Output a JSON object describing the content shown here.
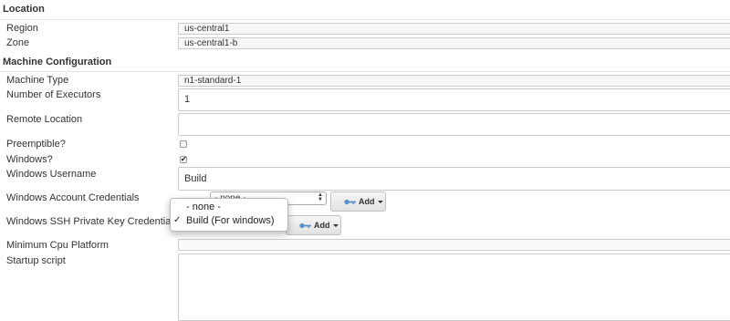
{
  "location": {
    "title": "Location",
    "region_label": "Region",
    "region_value": "us-central1",
    "zone_label": "Zone",
    "zone_value": "us-central1-b"
  },
  "machine": {
    "title": "Machine Configuration",
    "machine_type_label": "Machine Type",
    "machine_type_value": "n1-standard-1",
    "executors_label": "Number of Executors",
    "executors_value": "1",
    "remote_location_label": "Remote Location",
    "remote_location_value": "",
    "preemptible_label": "Preemptible?",
    "preemptible_checked": false,
    "windows_label": "Windows?",
    "windows_checked": true,
    "windows_checkmark": "✔",
    "windows_username_label": "Windows Username",
    "windows_username_value": "Build",
    "account_credentials_label": "Windows Account Credentials",
    "account_credentials_selected": "- none -",
    "ssh_key_label": "Windows SSH Private Key Credentials",
    "add_button_label": "Add",
    "min_cpu_label": "Minimum Cpu Platform",
    "min_cpu_value": "",
    "startup_script_label": "Startup script",
    "startup_script_value": ""
  },
  "dropdown": {
    "options": [
      "- none -",
      "Build (For windows)"
    ],
    "selected_index": 1,
    "checkmark": "✓"
  },
  "icons": {
    "key": "key-icon",
    "caret": "caret-down-icon",
    "select_arrows": "select-arrows-icon"
  },
  "colors": {
    "key_icon": "#5b8fc7",
    "field_border": "#cccccc",
    "readonly_bg": "#f7f7f7"
  }
}
